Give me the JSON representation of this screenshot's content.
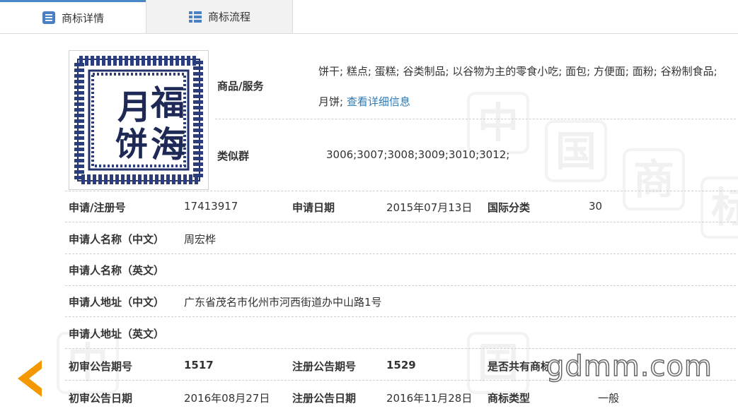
{
  "tabs": [
    {
      "label": "商标详情",
      "icon": "document-list-icon",
      "active": true
    },
    {
      "label": "商标流程",
      "icon": "grid-list-icon",
      "active": false
    }
  ],
  "goods_services": {
    "label": "商品/服务",
    "text": "饼干; 糕点; 蛋糕; 谷类制品; 以谷物为主的零食小吃; 面包; 方便面; 面粉; 谷粉制食品;",
    "text2": "月饼;",
    "link": "查看详细信息"
  },
  "similar_group": {
    "label": "类似群",
    "value": "3006;3007;3008;3009;3010;3012;"
  },
  "logo": {
    "chars": [
      "福",
      "海",
      "月",
      "饼"
    ]
  },
  "fields": {
    "reg_no": {
      "label": "申请/注册号",
      "value": "17413917"
    },
    "app_date": {
      "label": "申请日期",
      "value": "2015年07月13日"
    },
    "intl_class": {
      "label": "国际分类",
      "value": "30"
    },
    "applicant_cn": {
      "label": "申请人名称（中文）",
      "value": "周宏桦"
    },
    "applicant_en": {
      "label": "申请人名称（英文）",
      "value": ""
    },
    "address_cn": {
      "label": "申请人地址（中文）",
      "value": "广东省茂名市化州市河西街道办中山路1号"
    },
    "address_en": {
      "label": "申请人地址（英文）",
      "value": ""
    },
    "prelim_no": {
      "label": "初审公告期号",
      "value": "1517"
    },
    "reg_pub_no": {
      "label": "注册公告期号",
      "value": "1529"
    },
    "shared": {
      "label": "是否共有商标",
      "value": ""
    },
    "prelim_date": {
      "label": "初审公告日期",
      "value": "2016年08月27日"
    },
    "reg_pub_date": {
      "label": "注册公告日期",
      "value": "2016年11月28日"
    },
    "tm_type": {
      "label": "商标类型",
      "value": "一般"
    }
  },
  "watermark": {
    "text": "gdmm.com",
    "chars": [
      "中",
      "国",
      "商",
      "标",
      "中",
      "国",
      "商",
      "标"
    ]
  },
  "colors": {
    "accent": "#4a86c8",
    "link": "#2a7ab8",
    "arrow": "#f39800"
  }
}
